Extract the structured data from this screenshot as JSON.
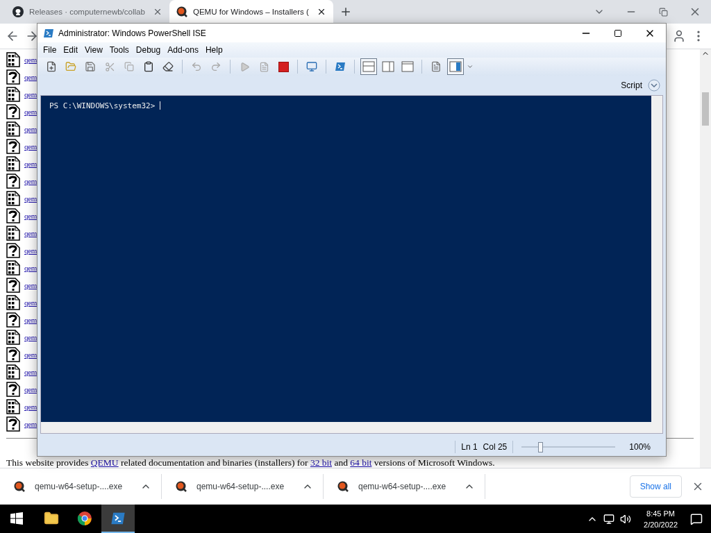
{
  "browser": {
    "tabs": [
      {
        "title": "Releases · computernewb/collab",
        "kind": "github",
        "selected": false
      },
      {
        "title": "QEMU for Windows – Installers (",
        "kind": "qemu",
        "selected": true
      }
    ],
    "page": {
      "files": [
        {
          "kind": "binary",
          "link": "qem"
        },
        {
          "kind": "unknown",
          "link": "qem"
        },
        {
          "kind": "binary",
          "link": "qem"
        },
        {
          "kind": "unknown",
          "link": "qem"
        },
        {
          "kind": "binary",
          "link": "qem"
        },
        {
          "kind": "unknown",
          "link": "qem"
        },
        {
          "kind": "binary",
          "link": "qem"
        },
        {
          "kind": "unknown",
          "link": "qem"
        },
        {
          "kind": "binary",
          "link": "qem"
        },
        {
          "kind": "unknown",
          "link": "qem"
        },
        {
          "kind": "binary",
          "link": "qem"
        },
        {
          "kind": "unknown",
          "link": "qem"
        },
        {
          "kind": "binary",
          "link": "qem"
        },
        {
          "kind": "unknown",
          "link": "qem"
        },
        {
          "kind": "binary",
          "link": "qem"
        },
        {
          "kind": "unknown",
          "link": "qem"
        },
        {
          "kind": "binary",
          "link": "qem"
        },
        {
          "kind": "unknown",
          "link": "qem"
        },
        {
          "kind": "binary",
          "link": "qem"
        },
        {
          "kind": "unknown",
          "link": "qem"
        },
        {
          "kind": "binary",
          "link": "qem"
        },
        {
          "kind": "unknown",
          "link": "qem"
        }
      ],
      "intro": [
        {
          "text": "This website provides ",
          "link": false
        },
        {
          "text": "QEMU",
          "link": true
        },
        {
          "text": " related documentation and binaries (installers) for ",
          "link": false
        },
        {
          "text": "32 bit",
          "link": true
        },
        {
          "text": " and ",
          "link": false
        },
        {
          "text": "64 bit",
          "link": true
        },
        {
          "text": " versions of Microsoft Windows.",
          "link": false
        }
      ]
    },
    "downloads": [
      {
        "filename": "qemu-w64-setup-....exe"
      },
      {
        "filename": "qemu-w64-setup-....exe"
      },
      {
        "filename": "qemu-w64-setup-....exe"
      }
    ],
    "show_all": "Show all"
  },
  "ise": {
    "title": "Administrator: Windows PowerShell ISE",
    "menu": [
      "File",
      "Edit",
      "View",
      "Tools",
      "Debug",
      "Add-ons",
      "Help"
    ],
    "layout_buttons": [
      {
        "selected": true
      },
      {
        "selected": false
      },
      {
        "selected": false
      }
    ],
    "script_pane_button": {
      "selected": true
    },
    "pane_label": "Script",
    "prompt": "PS C:\\WINDOWS\\system32> ",
    "status": {
      "line": "Ln 1",
      "column": "Col 25",
      "zoom": {
        "level": 0.2
      },
      "zoom_text": "100%"
    }
  },
  "taskbar": {
    "apps": [
      {
        "kind": "explorer",
        "selected": false
      },
      {
        "kind": "chrome",
        "selected": false
      },
      {
        "kind": "powershell",
        "selected": true
      }
    ],
    "time": "8:45 PM",
    "date": "2/20/2022"
  }
}
